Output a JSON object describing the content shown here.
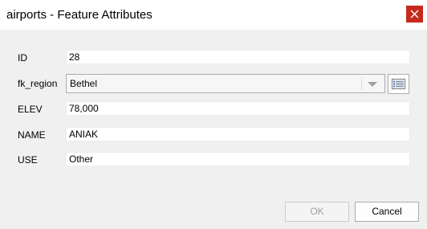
{
  "window": {
    "title": "airports - Feature Attributes",
    "close_label": "Close"
  },
  "fields": {
    "id": {
      "label": "ID",
      "value": "28"
    },
    "fk_region": {
      "label": "fk_region",
      "value": "Bethel"
    },
    "elev": {
      "label": "ELEV",
      "value": "78,000"
    },
    "name": {
      "label": "NAME",
      "value": "ANIAK"
    },
    "use": {
      "label": "USE",
      "value": "Other"
    }
  },
  "buttons": {
    "ok": "OK",
    "cancel": "Cancel"
  },
  "icons": {
    "close": "close-icon",
    "open_form": "open-form-icon",
    "dropdown": "chevron-down-icon"
  },
  "colors": {
    "close_bg": "#c42b1c",
    "titlebar": "#ffffff",
    "dialog_bg": "#f0f0f0"
  }
}
